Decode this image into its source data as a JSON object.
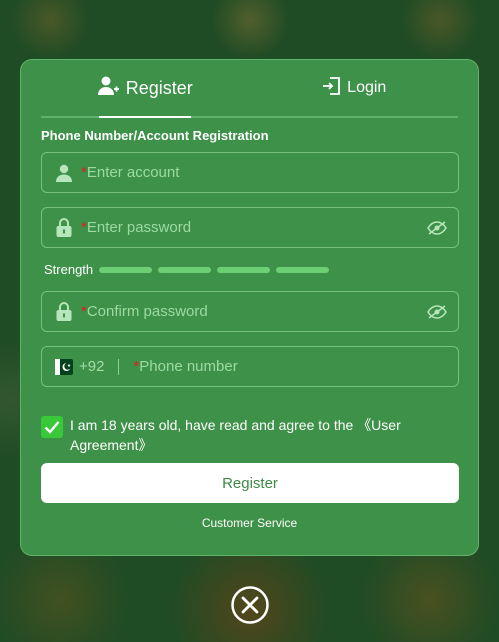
{
  "tabs": {
    "register": "Register",
    "login": "Login"
  },
  "form": {
    "section_title": "Phone Number/Account Registration",
    "required_mark": "*",
    "account_placeholder": "Enter account",
    "password_placeholder": "Enter password",
    "confirm_placeholder": "Confirm password",
    "phone_placeholder": "Phone number",
    "country_code": "+92",
    "country_flag": "pakistan-flag-icon",
    "strength_label": "Strength",
    "strength_level": 4,
    "agree_text": "I am 18 years old, have read and agree to the ",
    "agree_link": "《User Agreement》",
    "agree_checked": true,
    "submit_label": "Register",
    "customer_service": "Customer Service"
  },
  "colors": {
    "modal_bg": "#3d9148",
    "accent": "#38c83a",
    "required": "#e02020"
  }
}
